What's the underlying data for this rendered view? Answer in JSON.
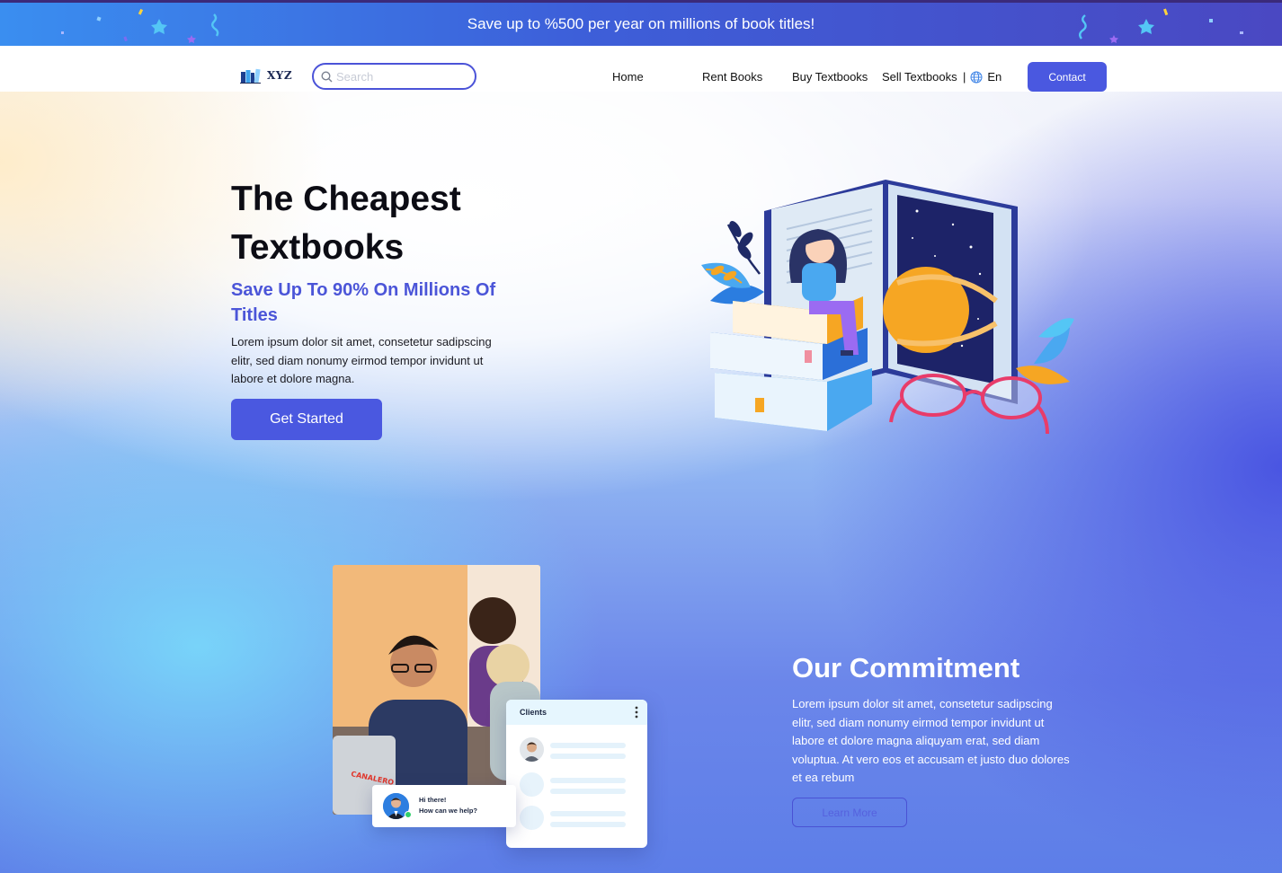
{
  "promo": {
    "text": "Save up to %500 per year on millions of book titles!"
  },
  "nav": {
    "logo_text": "XYZ",
    "search_placeholder": "Search",
    "search_value": "",
    "links": [
      "Home",
      "Rent Books",
      "Buy Textbooks",
      "Sell Textbooks"
    ],
    "separator": "|",
    "language": "En",
    "contact_label": "Contact"
  },
  "hero": {
    "title": "The Cheapest Textbooks",
    "subtitle": "Save Up To 90% On Millions Of Titles",
    "body": "Lorem ipsum dolor sit amet, consetetur sadipscing elitr, sed diam nonumy eirmod tempor invidunt ut labore et dolore magna.",
    "cta_label": "Get Started"
  },
  "commitment": {
    "title": "Our Commitment",
    "body": "Lorem ipsum dolor sit amet, consetetur sadipscing elitr, sed diam nonumy eirmod tempor invidunt ut labore et dolore magna aliquyam erat, sed diam voluptua. At vero eos et accusam et justo duo dolores et ea rebum",
    "learn_more_label": "Learn More",
    "clients_card": {
      "title": "Clients"
    },
    "chat_card": {
      "line1": "Hi there!",
      "line2": "How can we help?"
    }
  },
  "icons": {
    "search": "search-icon",
    "globe": "globe-icon",
    "kebab": "more-vertical-icon"
  },
  "colors": {
    "accent": "#4a58e0",
    "subtitle": "#4b55d8",
    "promo_start": "#3a8ef0",
    "promo_end": "#4a48c2"
  }
}
